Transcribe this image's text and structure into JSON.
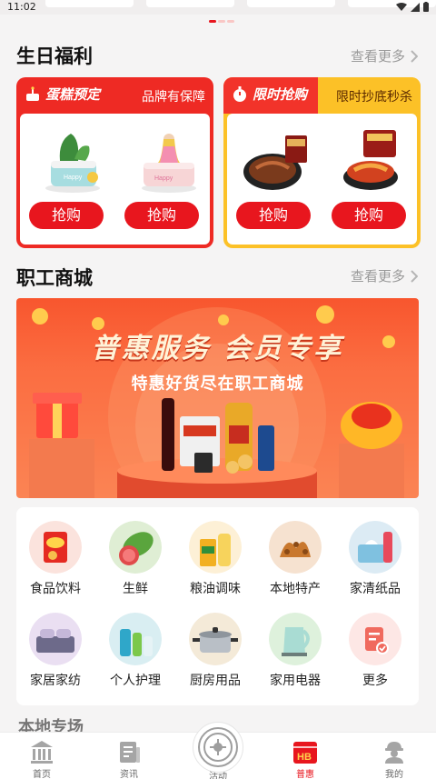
{
  "status_bar": {
    "time": "11:02"
  },
  "birthday": {
    "title": "生日福利",
    "more": "查看更多",
    "cake_card": {
      "tag": "蛋糕预定",
      "subtitle": "品牌有保障",
      "buy_left": "抢购",
      "buy_right": "抢购",
      "accent": "#ee2a24"
    },
    "flash_card": {
      "tag": "限时抢购",
      "subtitle": "限时抄底秒杀",
      "buy_left": "抢购",
      "buy_right": "抢购",
      "accent": "#fcc127"
    }
  },
  "mall": {
    "title": "职工商城",
    "more": "查看更多",
    "banner": {
      "headline": "普惠服务 会员专享",
      "subline": "特惠好货尽在职工商城"
    }
  },
  "categories": [
    {
      "label": "食品饮料",
      "icon": "snacks-icon"
    },
    {
      "label": "生鲜",
      "icon": "fresh-fruit-icon"
    },
    {
      "label": "粮油调味",
      "icon": "oil-rice-icon"
    },
    {
      "label": "本地特产",
      "icon": "local-specialty-icon"
    },
    {
      "label": "家清纸品",
      "icon": "tissue-icon"
    },
    {
      "label": "家居家纺",
      "icon": "bedding-icon"
    },
    {
      "label": "个人护理",
      "icon": "personal-care-icon"
    },
    {
      "label": "厨房用品",
      "icon": "kitchen-pot-icon"
    },
    {
      "label": "家用电器",
      "icon": "kettle-icon"
    },
    {
      "label": "更多",
      "icon": "more-icon"
    }
  ],
  "peek_section": {
    "title": "本地专场"
  },
  "tabbar": {
    "items": [
      {
        "label": "首页",
        "icon": "home-building-icon"
      },
      {
        "label": "资讯",
        "icon": "news-icon"
      },
      {
        "label": "活动",
        "icon": "union-logo-icon"
      },
      {
        "label": "普惠",
        "icon": "puhui-icon"
      },
      {
        "label": "我的",
        "icon": "worker-profile-icon"
      }
    ],
    "active_index": 3,
    "active_color": "#e8161e"
  },
  "colors": {
    "brand_red": "#e8161e",
    "flash_yellow": "#fcc127",
    "background": "#f5f4f4"
  }
}
